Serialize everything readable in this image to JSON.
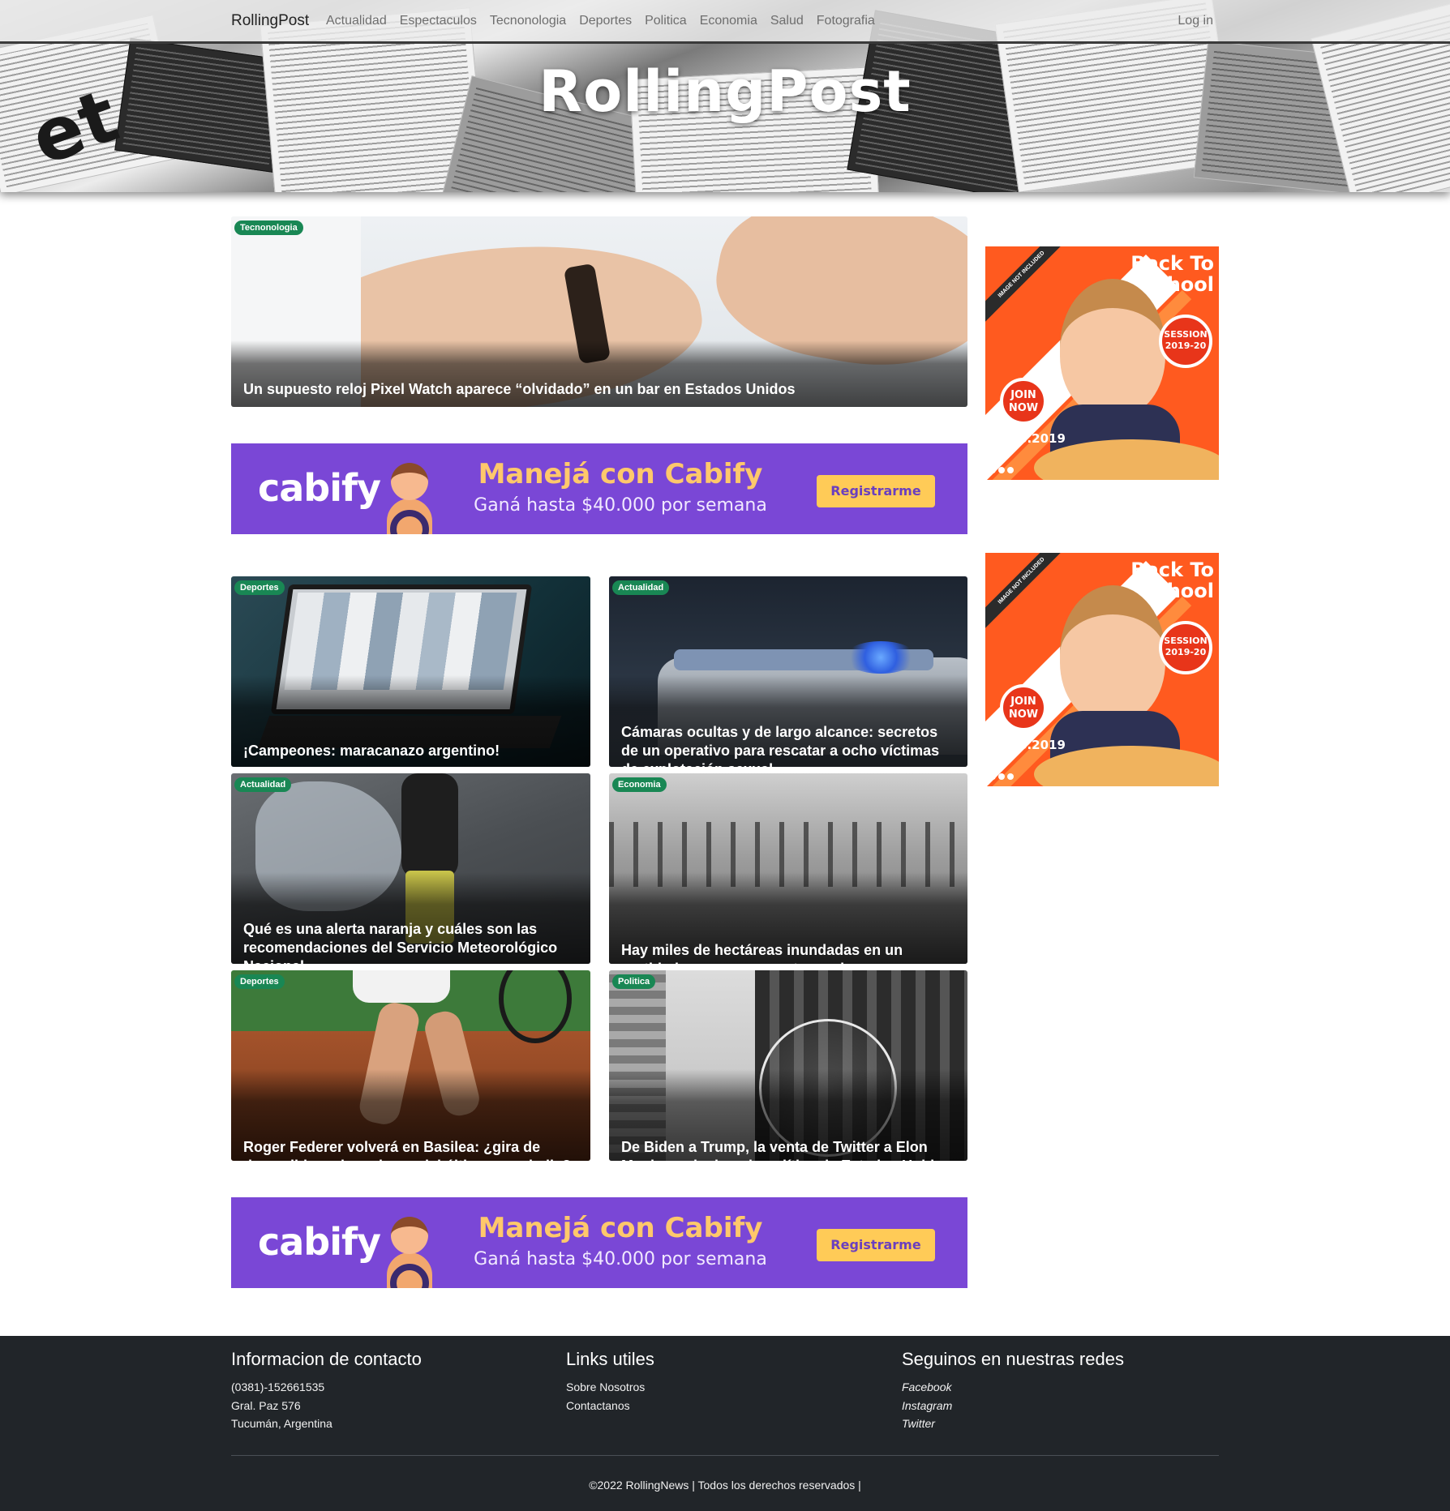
{
  "navbar": {
    "brand": "RollingPost",
    "items": [
      "Actualidad",
      "Espectaculos",
      "Tecnonologia",
      "Deportes",
      "Politica",
      "Economia",
      "Salud",
      "Fotografia"
    ],
    "login": "Log in"
  },
  "hero": {
    "title": "RollingPost"
  },
  "featured": {
    "category": "Tecnonologia",
    "title": "Un supuesto reloj Pixel Watch aparece “olvidado” en un bar en Estados Unidos"
  },
  "ads": {
    "banner": {
      "logo": "cabify",
      "headline": "Manejá con Cabify",
      "subline": "Ganá hasta $40.000 por semana",
      "cta": "Registrarme",
      "color": "#7a47d6"
    },
    "side": {
      "title_line1": "Back To",
      "title_line2": "School",
      "session": "SESSION 2019-20",
      "join": "JOIN NOW",
      "date": "20.08.2019",
      "corner": "IMAGE NOT INCLUDED"
    }
  },
  "news": [
    {
      "category": "Deportes",
      "title": "¡Campeones: maracanazo argentino!"
    },
    {
      "category": "Actualidad",
      "title": "Cámaras ocultas y de largo alcance: secretos de un operativo para rescatar a ocho víctimas de explotación sexual"
    },
    {
      "category": "Actualidad",
      "title": "Qué es una alerta naranja y cuáles son las recomendaciones del Servicio Meteorológico Nacional"
    },
    {
      "category": "Economia",
      "title": "Hay miles de hectáreas inundadas en un partido bonaerense y ya temen lo peor"
    },
    {
      "category": "Deportes",
      "title": "Roger Federer volverá en Basilea: ¿gira de despedida o el comienzo del último gran baile?"
    },
    {
      "category": "Politica",
      "title": "De Biden a Trump, la venta de Twitter a Elon Musk revoluciona la política de Estados Unidos"
    }
  ],
  "footer": {
    "contact": {
      "heading": "Informacion de contacto",
      "phone": "(0381)-152661535",
      "address": "Gral. Paz 576",
      "city": "Tucumán, Argentina"
    },
    "links": {
      "heading": "Links utiles",
      "items": [
        "Sobre Nosotros",
        "Contactanos"
      ]
    },
    "social": {
      "heading": "Seguinos en nuestras redes",
      "items": [
        "Facebook",
        "Instagram",
        "Twitter"
      ]
    },
    "copyright": "©2022 RollingNews | Todos los derechos reservados |"
  },
  "colors": {
    "badge": "#198754",
    "footer_bg": "#212529",
    "ad_purple": "#7a47d6",
    "ad_orange": "#ff5a1f"
  }
}
